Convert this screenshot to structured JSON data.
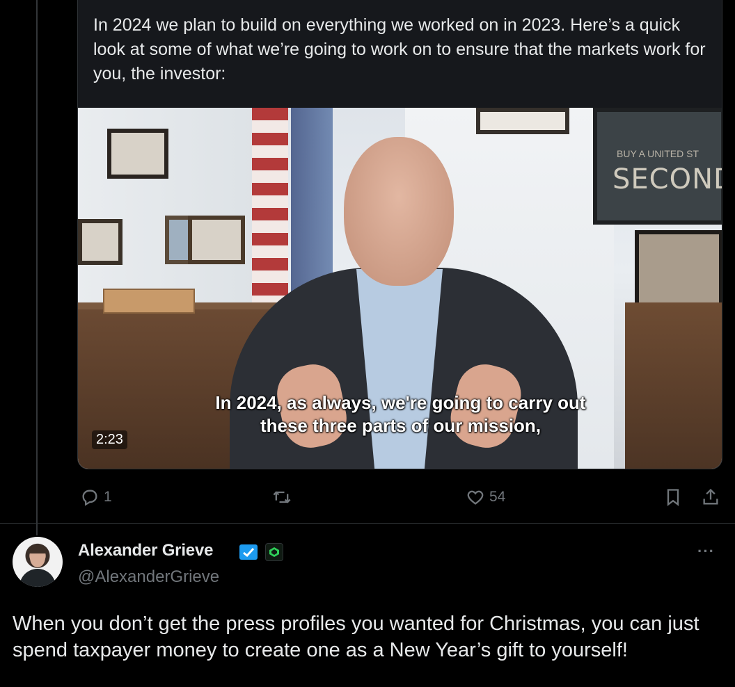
{
  "quoted_post": {
    "text": "In 2024 we plan to build on everything we worked on in 2023. Here’s a quick look at some of what we’re going to work on to ensure that the markets work for you, the investor:",
    "video": {
      "caption_line1": "In 2024, as always, we're going to carry out",
      "caption_line2": "these three parts of our mission,",
      "timestamp": "2:23",
      "poster_text_small": "BUY A UNITED ST",
      "poster_text_large": "SECOND LIBI"
    },
    "actions": {
      "reply_count": "1",
      "retweet_count": "",
      "like_count": "54",
      "reply_icon": "reply-icon",
      "retweet_icon": "retweet-icon",
      "like_icon": "heart-icon",
      "bookmark_icon": "bookmark-icon",
      "share_icon": "share-icon"
    }
  },
  "post": {
    "author_name": "Alexander Grieve",
    "author_handle": "@AlexanderGrieve",
    "more_label": "···",
    "text": "When you don’t get the press profiles you wanted for Christmas, you can just spend taxpayer money to create one as a New Year’s gift to yourself!",
    "verified_badge_color": "#1d9bf0",
    "affiliate_badge_color": "#2fd15a"
  },
  "colors": {
    "background": "#000000",
    "text": "#e7e9ea",
    "muted": "#71767b",
    "border": "#2f3336",
    "card_bg": "#16181c"
  }
}
